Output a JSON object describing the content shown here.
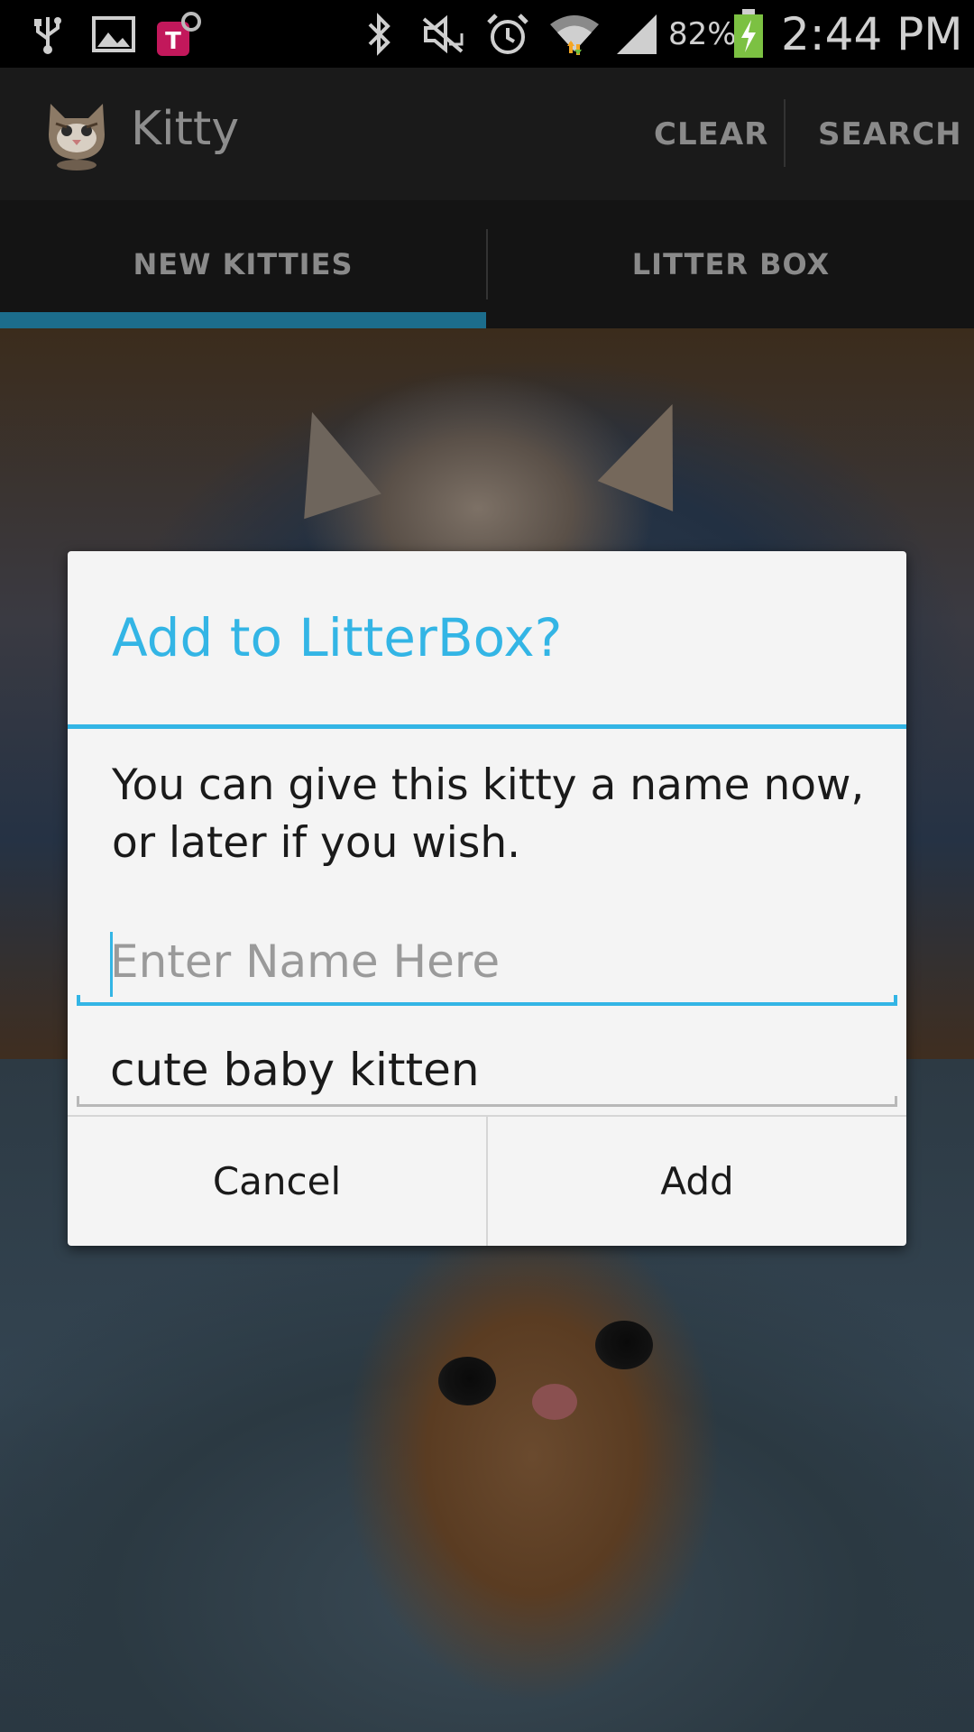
{
  "status_bar": {
    "battery": "82%",
    "time": "2:44 PM",
    "icons": [
      "usb-icon",
      "gallery-icon",
      "tmobile-icon",
      "bluetooth-icon",
      "mute-icon",
      "alarm-icon",
      "wifi-icon",
      "signal-icon",
      "battery-charging-icon"
    ]
  },
  "action_bar": {
    "app_icon": "kitten-app-icon",
    "title": "Kitty",
    "clear_label": "CLEAR",
    "search_label": "SEARCH"
  },
  "tabs": [
    {
      "label": "NEW KITTIES",
      "selected": true
    },
    {
      "label": "LITTER BOX",
      "selected": false
    }
  ],
  "colors": {
    "accent": "#33b5e5",
    "tab_indicator": "#1c6d8c",
    "dialog_bg": "#f4f4f4"
  },
  "dialog": {
    "title": "Add to LitterBox?",
    "message": "You can give this kitty a name now, or later if you wish.",
    "name_field": {
      "value": "",
      "placeholder": "Enter Name Here"
    },
    "description_field": {
      "value": "cute baby kitten"
    },
    "cancel_label": "Cancel",
    "add_label": "Add"
  }
}
